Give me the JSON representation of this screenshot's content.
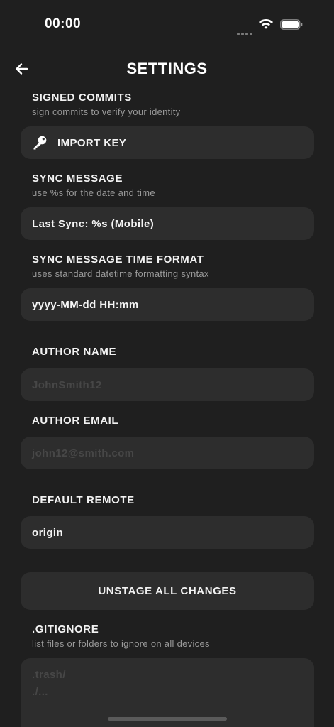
{
  "status_bar": {
    "time": "00:00"
  },
  "header": {
    "title": "SETTINGS"
  },
  "signed_commits": {
    "title": "SIGNED COMMITS",
    "subtitle": "sign commits to verify your identity",
    "button_label": "IMPORT KEY"
  },
  "sync_message": {
    "title": "SYNC MESSAGE",
    "subtitle": "use %s for the date and time",
    "value": "Last Sync: %s (Mobile)"
  },
  "sync_time_format": {
    "title": "SYNC MESSAGE TIME FORMAT",
    "subtitle": "uses standard datetime formatting syntax",
    "value": "yyyy-MM-dd HH:mm"
  },
  "author_name": {
    "title": "AUTHOR NAME",
    "placeholder": "JohnSmith12"
  },
  "author_email": {
    "title": "AUTHOR EMAIL",
    "placeholder": "john12@smith.com"
  },
  "default_remote": {
    "title": "DEFAULT REMOTE",
    "value": "origin"
  },
  "unstage_button": {
    "label": "UNSTAGE ALL CHANGES"
  },
  "gitignore": {
    "title": ".GITIGNORE",
    "subtitle": "list files or folders to ignore on all devices",
    "placeholder_lines": [
      ".trash/",
      "./..."
    ]
  },
  "colors": {
    "background": "#1f1f1f",
    "field": "#2d2d2d",
    "placeholder": "#474747",
    "subtitle": "#9a9a9a"
  },
  "icons": {
    "back": "arrow-left-icon",
    "key": "key-icon",
    "wifi": "wifi-icon",
    "battery": "battery-icon"
  }
}
